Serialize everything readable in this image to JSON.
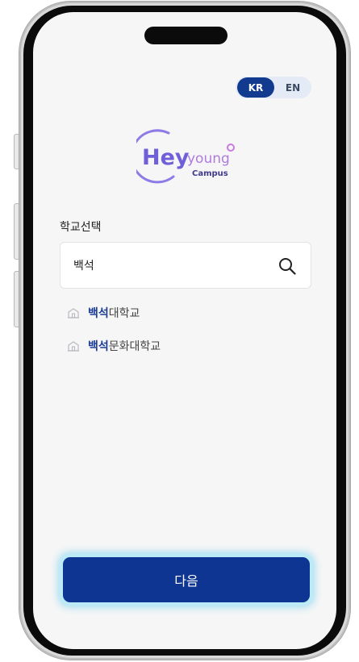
{
  "language_toggle": {
    "kr_label": "KR",
    "en_label": "EN",
    "selected": "KR"
  },
  "logo": {
    "word_hey": "Hey",
    "word_young": "young",
    "sub": "Campus",
    "colors": {
      "hey": "#6f5fd8",
      "young": "#b07ae0",
      "campus": "#3f3a8c",
      "ring": "#8f7be8"
    }
  },
  "school_select": {
    "label": "학교선택",
    "search_value": "백석",
    "search_placeholder": ""
  },
  "results": [
    {
      "highlight": "백석",
      "rest": "대학교"
    },
    {
      "highlight": "백석",
      "rest": "문화대학교"
    }
  ],
  "next_button": {
    "label": "다음"
  },
  "colors": {
    "primary": "#0f3592",
    "highlight_text": "#1b3d94",
    "glow": "#9fdcf1"
  }
}
